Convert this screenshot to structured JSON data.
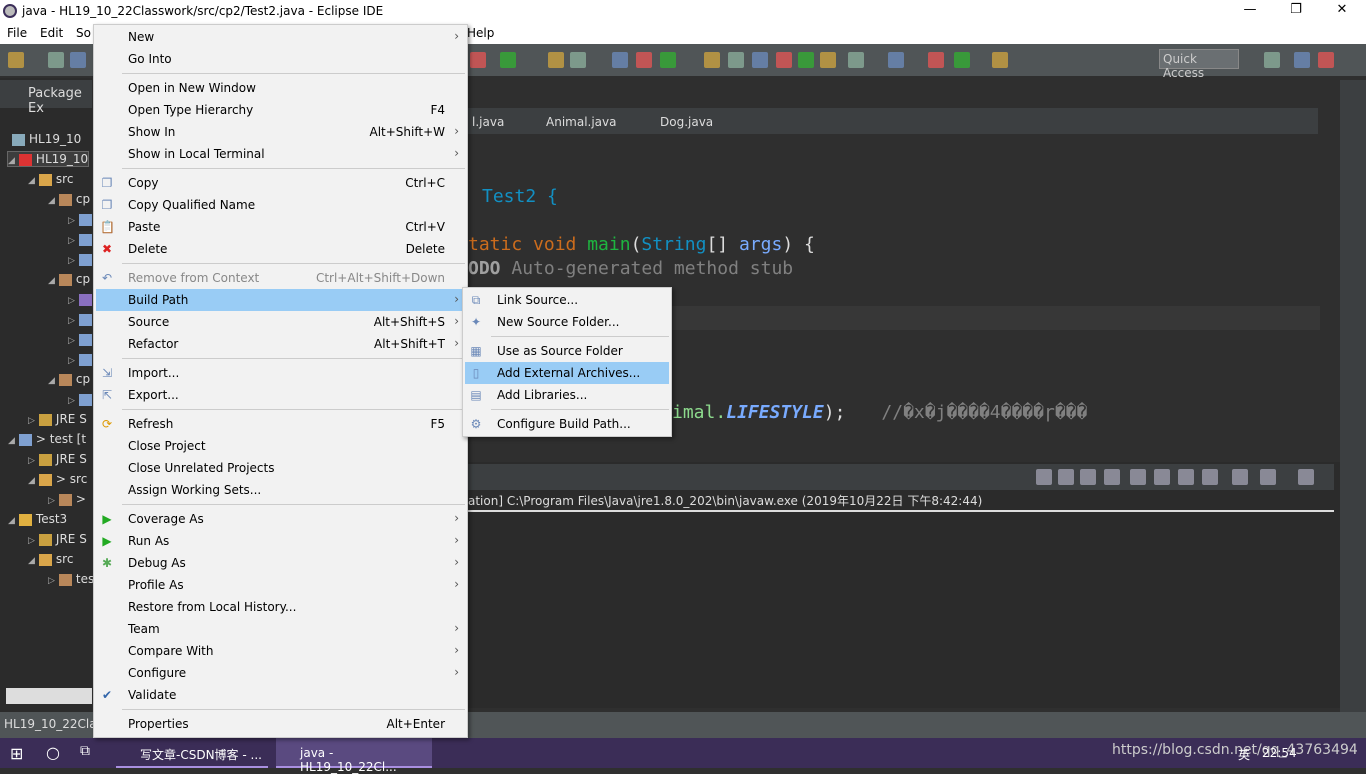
{
  "window": {
    "title": "java - HL19_10_22Classwork/src/cp2/Test2.java - Eclipse IDE",
    "minimize": "—",
    "maximize": "❐",
    "close": "✕"
  },
  "menubar": {
    "items": [
      "File",
      "Edit",
      "So",
      "Help"
    ]
  },
  "quick_access": "Quick Access",
  "package_explorer": {
    "title": "Package Ex",
    "items": [
      {
        "label": "HL19_10",
        "icon": "project-closed-icon"
      },
      {
        "label": "HL19_10",
        "icon": "project-error-icon",
        "selected": true
      },
      {
        "label": "src",
        "icon": "source-folder-icon"
      },
      {
        "label": "cp",
        "icon": "package-icon"
      },
      {
        "label": "",
        "icon": "java-abstract-file-icon"
      },
      {
        "label": "",
        "icon": "java-file-icon"
      },
      {
        "label": "",
        "icon": "java-file-icon"
      },
      {
        "label": "cp",
        "icon": "package-icon"
      },
      {
        "label": "",
        "icon": "java-interface-file-icon"
      },
      {
        "label": "",
        "icon": "java-file-icon"
      },
      {
        "label": "",
        "icon": "java-abstract-file-icon"
      },
      {
        "label": "",
        "icon": "java-file-icon"
      },
      {
        "label": "cp",
        "icon": "package-icon"
      },
      {
        "label": "",
        "icon": "java-file-icon"
      },
      {
        "label": "JRE S",
        "icon": "library-icon"
      },
      {
        "label": "> test [t",
        "icon": "project-icon"
      },
      {
        "label": "JRE S",
        "icon": "library-icon"
      },
      {
        "label": "> src",
        "icon": "source-folder-icon"
      },
      {
        "label": ">",
        "icon": "package-icon"
      },
      {
        "label": "Test3",
        "icon": "project-warning-icon"
      },
      {
        "label": "JRE S",
        "icon": "library-icon"
      },
      {
        "label": "src",
        "icon": "source-folder-icon"
      },
      {
        "label": "tes",
        "icon": "package-icon"
      }
    ]
  },
  "editor": {
    "tabs": [
      "l.java",
      "Animal.java",
      "Dog.java"
    ],
    "code": {
      "class_decl": "Test2 {",
      "main_kw": "tatic void ",
      "main_name": "main",
      "main_paren": "(",
      "main_type": "String",
      "main_rest": "[] ",
      "main_args": "args",
      "main_end": ") {",
      "todo": "ODO",
      "todo_rest": " Auto-generated method stub",
      "print_pre": "imal.",
      "print_field": "LIFESTYLE",
      "print_end": ");",
      "comment": "//�x�j����4����ɼ���"
    }
  },
  "console": {
    "line": "ation] C:\\Program Files\\Java\\jre1.8.0_202\\bin\\javaw.exe (2019年10月22日 下午8:42:44)"
  },
  "status": {
    "text": "HL19_10_22Clas"
  },
  "context_menu": {
    "items": [
      {
        "label": "New",
        "submenu": true
      },
      {
        "label": "Go Into"
      },
      {
        "sep": true
      },
      {
        "label": "Open in New Window"
      },
      {
        "label": "Open Type Hierarchy",
        "shortcut": "F4"
      },
      {
        "label": "Show In",
        "shortcut": "Alt+Shift+W",
        "submenu": true
      },
      {
        "label": "Show in Local Terminal",
        "submenu": true
      },
      {
        "sep": true
      },
      {
        "label": "Copy",
        "shortcut": "Ctrl+C",
        "icon": "copy-icon"
      },
      {
        "label": "Copy Qualified Name",
        "icon": "copy-qualified-icon"
      },
      {
        "label": "Paste",
        "shortcut": "Ctrl+V",
        "icon": "paste-icon"
      },
      {
        "label": "Delete",
        "shortcut": "Delete",
        "icon": "delete-icon"
      },
      {
        "sep": true
      },
      {
        "label": "Remove from Context",
        "shortcut": "Ctrl+Alt+Shift+Down",
        "disabled": true,
        "icon": "remove-context-icon"
      },
      {
        "label": "Build Path",
        "submenu": true,
        "highlighted": true
      },
      {
        "label": "Source",
        "shortcut": "Alt+Shift+S",
        "submenu": true
      },
      {
        "label": "Refactor",
        "shortcut": "Alt+Shift+T",
        "submenu": true
      },
      {
        "sep": true
      },
      {
        "label": "Import...",
        "icon": "import-icon"
      },
      {
        "label": "Export...",
        "icon": "export-icon"
      },
      {
        "sep": true
      },
      {
        "label": "Refresh",
        "shortcut": "F5",
        "icon": "refresh-icon"
      },
      {
        "label": "Close Project"
      },
      {
        "label": "Close Unrelated Projects"
      },
      {
        "label": "Assign Working Sets..."
      },
      {
        "sep": true
      },
      {
        "label": "Coverage As",
        "submenu": true,
        "icon": "coverage-icon"
      },
      {
        "label": "Run As",
        "submenu": true,
        "icon": "run-icon"
      },
      {
        "label": "Debug As",
        "submenu": true,
        "icon": "debug-icon"
      },
      {
        "label": "Profile As",
        "submenu": true
      },
      {
        "label": "Restore from Local History..."
      },
      {
        "label": "Team",
        "submenu": true
      },
      {
        "label": "Compare With",
        "submenu": true
      },
      {
        "label": "Configure",
        "submenu": true
      },
      {
        "label": "Validate",
        "icon": "checkmark-icon"
      },
      {
        "sep": true
      },
      {
        "label": "Properties",
        "shortcut": "Alt+Enter"
      }
    ]
  },
  "build_path_menu": {
    "items": [
      {
        "label": "Link Source...",
        "icon": "link-source-icon"
      },
      {
        "label": "New Source Folder...",
        "icon": "new-source-folder-icon"
      },
      {
        "sep": true
      },
      {
        "label": "Use as Source Folder",
        "icon": "use-source-folder-icon"
      },
      {
        "label": "Add External Archives...",
        "icon": "jar-icon",
        "highlighted": true
      },
      {
        "label": "Add Libraries...",
        "icon": "library-icon"
      },
      {
        "sep": true
      },
      {
        "label": "Configure Build Path...",
        "icon": "configure-build-path-icon"
      }
    ]
  },
  "taskbar": {
    "tasks": [
      "写文章-CSDN博客 - ...",
      "java - HL19_10_22Cl..."
    ],
    "tray": "https://blog.csdn.net/qq_43763494",
    "clock": "22:54",
    "ime": "英"
  },
  "colors": {
    "keyword": "#cc6c1d",
    "method": "#1eb540",
    "type": "#1290c3",
    "param": "#79abff",
    "comment": "#808080",
    "field": "#8dda8d",
    "highlight": "#99ccf5"
  }
}
